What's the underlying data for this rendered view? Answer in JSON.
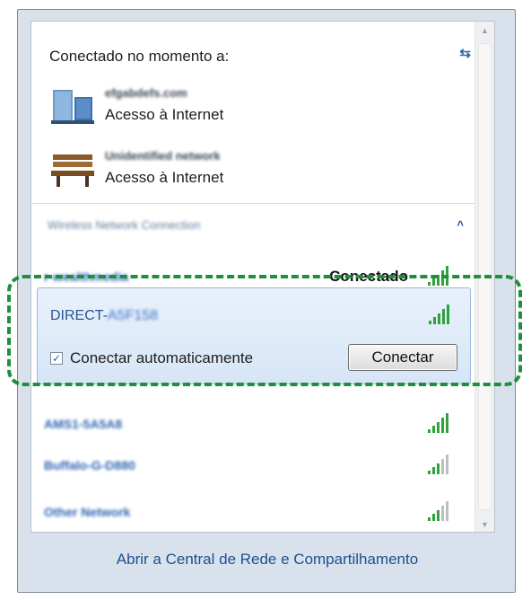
{
  "header": {
    "label": "Conectado no momento a:",
    "refresh_icon": "refresh-icon"
  },
  "connections": [
    {
      "icon": "network-domain-icon",
      "name": "efgabdefs.com",
      "status": "Acesso à Internet"
    },
    {
      "icon": "park-bench-icon",
      "name": "Unidentified network",
      "status": "Acesso à Internet"
    }
  ],
  "wireless_section": {
    "title": "Wireless Network Connection",
    "collapse_symbol": "^"
  },
  "networks": [
    {
      "name": "r-wealthmedia",
      "status": "Conectado",
      "signal_bars": 5
    },
    {
      "name_prefix": "DIRECT-",
      "name_suffix": "A5F158",
      "signal_bars": 5,
      "selected": true,
      "auto_connect_label": "Conectar automaticamente",
      "auto_connect_checked": true,
      "connect_button": "Conectar"
    },
    {
      "name": "AMS1-5A5A8",
      "signal_bars": 5
    },
    {
      "name": "Buffalo-G-D880",
      "signal_bars": 3
    },
    {
      "name": "Other Network",
      "signal_bars": 3
    }
  ],
  "footer": {
    "link": "Abrir a Central de Rede e Compartilhamento"
  },
  "colors": {
    "accent": "#2f64b3",
    "highlight": "#1e8f3c",
    "signal": "#2fa33a"
  }
}
